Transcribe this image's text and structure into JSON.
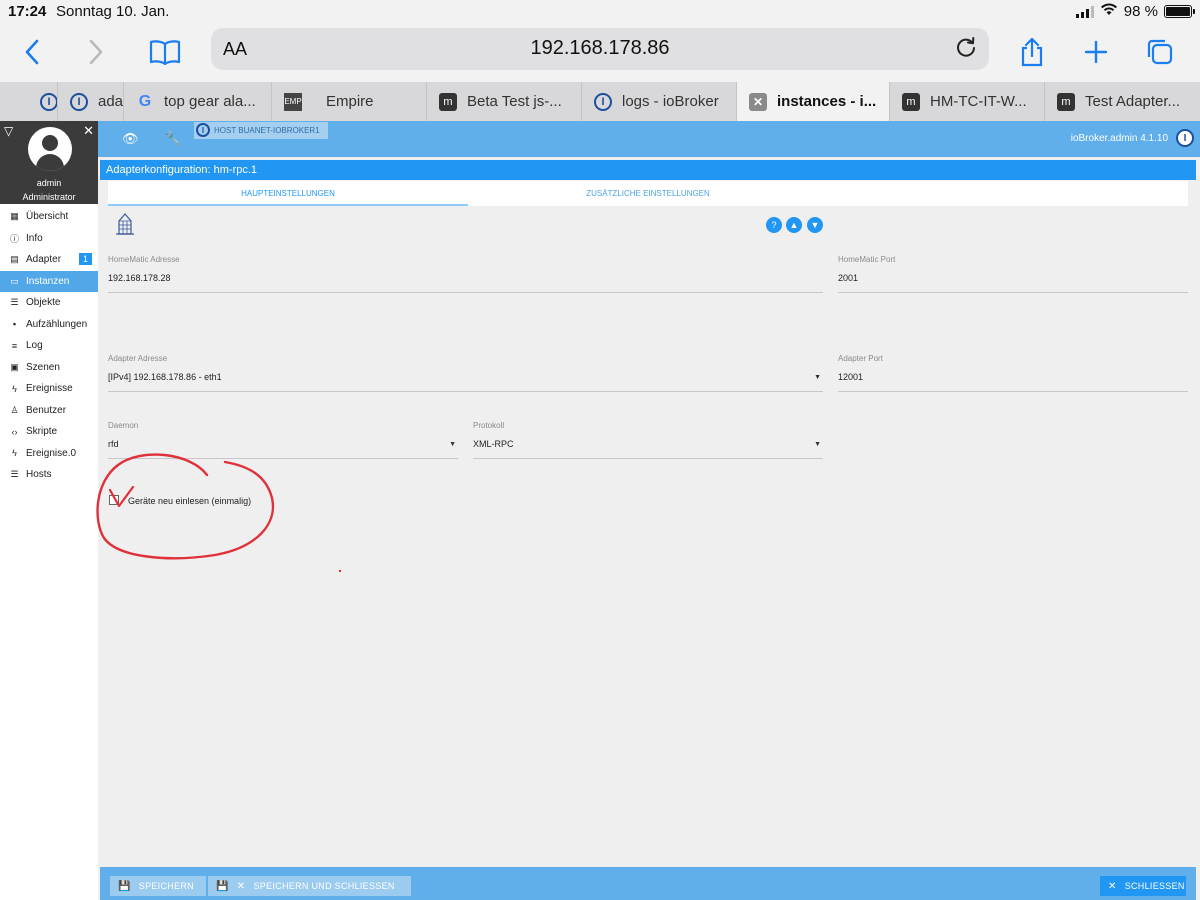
{
  "status": {
    "time": "17:24",
    "date": "Sonntag 10. Jan.",
    "battery": "98 %",
    "battery_level": 0.98
  },
  "browser": {
    "aa_label": "AA",
    "url": "192.168.178.86",
    "tabs": [
      {
        "label": "",
        "favicon": "iobroker-icon"
      },
      {
        "label": "ada",
        "favicon": "iobroker-icon"
      },
      {
        "label": "top gear ala...",
        "favicon": "google-icon"
      },
      {
        "label": "Empire",
        "favicon": "empire-icon"
      },
      {
        "label": "Beta Test js-...",
        "favicon": "forum-icon"
      },
      {
        "label": "logs - ioBroker",
        "favicon": "iobroker-icon"
      },
      {
        "label": "instances - i...",
        "favicon": "close-tab-icon"
      },
      {
        "label": "HM-TC-IT-W...",
        "favicon": "forum-icon"
      },
      {
        "label": "Test Adapter...",
        "favicon": "forum-icon"
      }
    ]
  },
  "sidebar": {
    "user_name": "admin",
    "user_role": "Administrator",
    "items": [
      {
        "label": "Übersicht",
        "icon": "grid-icon"
      },
      {
        "label": "Info",
        "icon": "info-icon"
      },
      {
        "label": "Adapter",
        "icon": "store-icon",
        "badge": "1"
      },
      {
        "label": "Instanzen",
        "icon": "instances-icon"
      },
      {
        "label": "Objekte",
        "icon": "list-icon"
      },
      {
        "label": "Aufzählungen",
        "icon": "enum-icon"
      },
      {
        "label": "Log",
        "icon": "log-icon"
      },
      {
        "label": "Szenen",
        "icon": "scene-icon"
      },
      {
        "label": "Ereignisse",
        "icon": "bolt-icon"
      },
      {
        "label": "Benutzer",
        "icon": "user-icon"
      },
      {
        "label": "Skripte",
        "icon": "code-icon"
      },
      {
        "label": "Ereignise.0",
        "icon": "bolt-icon"
      },
      {
        "label": "Hosts",
        "icon": "hosts-icon"
      }
    ]
  },
  "appbar": {
    "host_label": "HOST BUANET-IOBROKER1",
    "version": "ioBroker.admin 4.1.10"
  },
  "dialog": {
    "title": "Adapterkonfiguration: hm-rpc.1",
    "tabs": [
      "HAUPTEINSTELLUNGEN",
      "ZUSÄTZLICHE EINSTELLUNGEN"
    ],
    "fields": {
      "homematic_address": {
        "label": "HomeMatic Adresse",
        "value": "192.168.178.28"
      },
      "homematic_port": {
        "label": "HomeMatic Port",
        "value": "2001"
      },
      "adapter_address": {
        "label": "Adapter Adresse",
        "value": "[IPv4] 192.168.178.86 - eth1"
      },
      "adapter_port": {
        "label": "Adapter Port",
        "value": "12001"
      },
      "daemon": {
        "label": "Daemon",
        "value": "rfd"
      },
      "protocol": {
        "label": "Protokoll",
        "value": "XML-RPC"
      }
    },
    "checkbox_label": "Geräte neu einlesen (einmalig)"
  },
  "footer": {
    "save": "SPEICHERN",
    "save_close": "SPEICHERN UND SCHLIESSEN",
    "close": "SCHLIESSEN"
  },
  "colors": {
    "accent": "#2196f3",
    "appbar": "#60aeea",
    "annotation": "#e0303a"
  }
}
